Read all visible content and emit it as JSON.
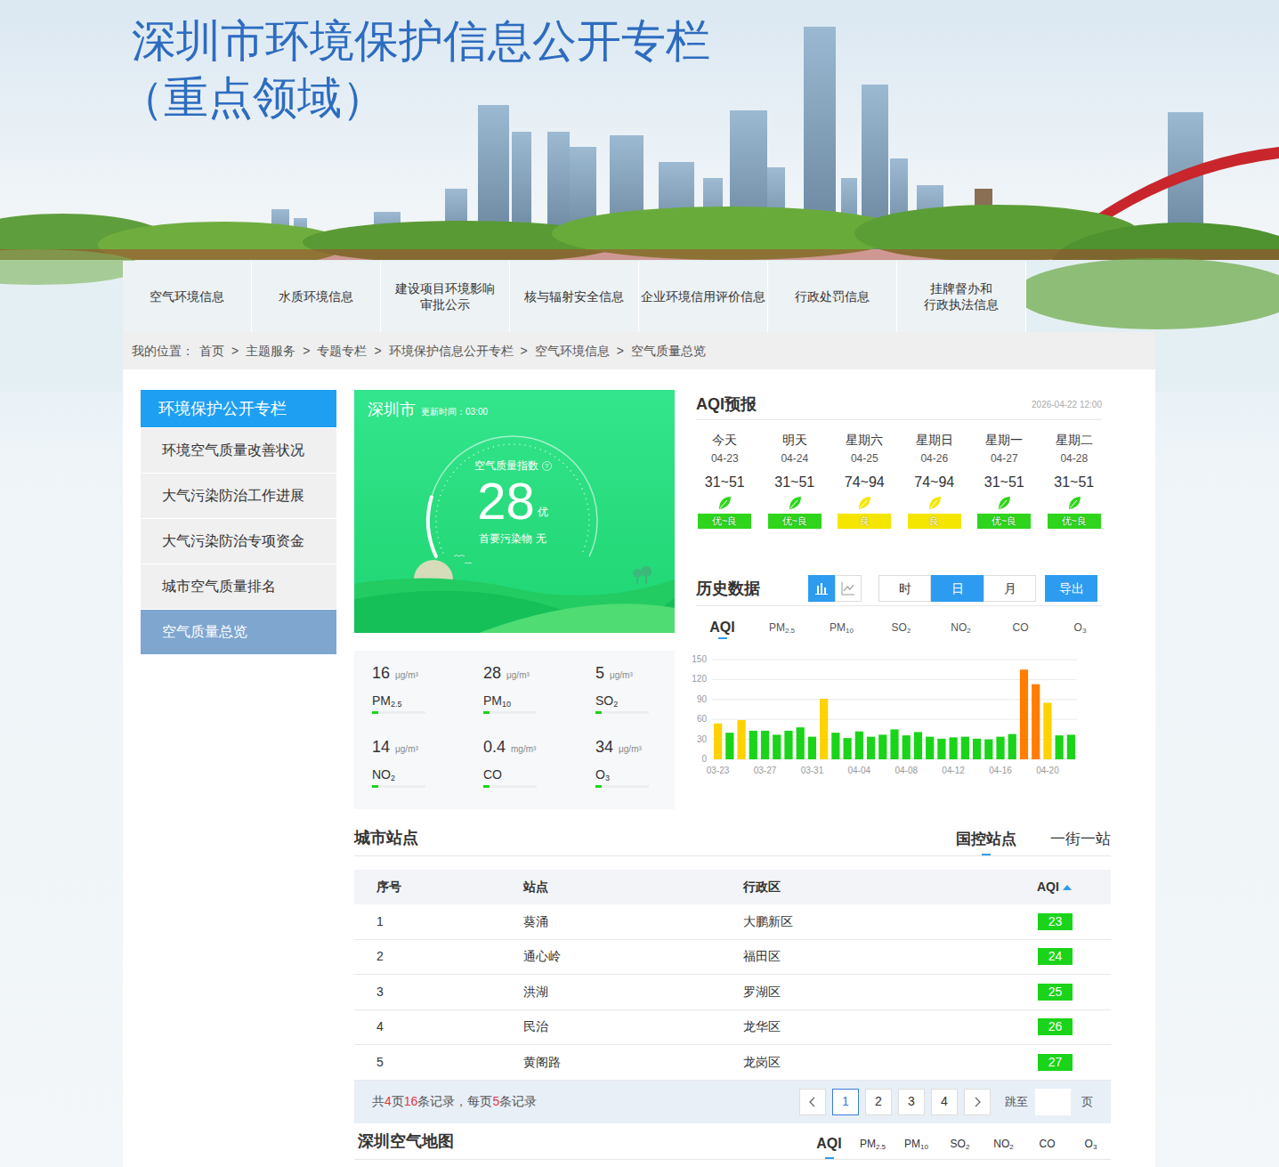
{
  "header": {
    "title": "深圳市环境保护信息公开专栏",
    "subtitle": "（重点领域）"
  },
  "nav": [
    {
      "lines": [
        "空气环境信息"
      ]
    },
    {
      "lines": [
        "水质环境信息"
      ]
    },
    {
      "lines": [
        "建设项目环境影响",
        "审批公示"
      ]
    },
    {
      "lines": [
        "核与辐射安全信息"
      ]
    },
    {
      "lines": [
        "企业环境信用评价信息"
      ]
    },
    {
      "lines": [
        "行政处罚信息"
      ]
    },
    {
      "lines": [
        "挂牌督办和",
        "行政执法信息"
      ]
    }
  ],
  "breadcrumb": {
    "label": "我的位置：",
    "separator": ">",
    "items": [
      "首页",
      "主题服务",
      "专题专栏",
      "环境保护信息公开专栏",
      "空气环境信息",
      "空气质量总览"
    ]
  },
  "sidebar": {
    "title": "环境保护公开专栏",
    "items": [
      {
        "label": "环境空气质量改善状况",
        "selected": false
      },
      {
        "label": "大气污染防治工作进展",
        "selected": false
      },
      {
        "label": "大气污染防治专项资金",
        "selected": false
      },
      {
        "label": "城市空气质量排名",
        "selected": false
      },
      {
        "label": "空气质量总览",
        "selected": true
      }
    ]
  },
  "current": {
    "city": "深圳市",
    "update_label": "更新时间：",
    "update_time": "03:00",
    "index_label": "空气质量指数",
    "help": "?",
    "aqi": "28",
    "grade": "优",
    "gauge": 0.18,
    "primary_label": "首要污染物",
    "primary": "无"
  },
  "pollutants": [
    {
      "value": "16",
      "unit": "μg/m³",
      "name": {
        "base": "PM",
        "sub": "2.5"
      },
      "level": 0.12,
      "color": "#1ad41a"
    },
    {
      "value": "28",
      "unit": "μg/m³",
      "name": {
        "base": "PM",
        "sub": "10"
      },
      "level": 0.12,
      "color": "#1ad41a"
    },
    {
      "value": "5",
      "unit": "μg/m³",
      "name": {
        "base": "SO",
        "sub": "2"
      },
      "level": 0.12,
      "color": "#1ad41a"
    },
    {
      "value": "14",
      "unit": "μg/m³",
      "name": {
        "base": "NO",
        "sub": "2"
      },
      "level": 0.12,
      "color": "#1ad41a"
    },
    {
      "value": "0.4",
      "unit": "mg/m³",
      "name": {
        "base": "CO",
        "sub": ""
      },
      "level": 0.12,
      "color": "#1ad41a"
    },
    {
      "value": "34",
      "unit": "μg/m³",
      "name": {
        "base": "O",
        "sub": "3"
      },
      "level": 0.12,
      "color": "#1ad41a"
    }
  ],
  "forecast": {
    "title": "AQI预报",
    "issued": "2026-04-22 12:00",
    "days": [
      {
        "day": "今天",
        "date": "04-23",
        "range": "31~51",
        "grade": "优~良",
        "color": "#2fd51c"
      },
      {
        "day": "明天",
        "date": "04-24",
        "range": "31~51",
        "grade": "优~良",
        "color": "#2fd51c"
      },
      {
        "day": "星期六",
        "date": "04-25",
        "range": "74~94",
        "grade": "良",
        "color": "#f5e600"
      },
      {
        "day": "星期日",
        "date": "04-26",
        "range": "74~94",
        "grade": "良",
        "color": "#f5e600"
      },
      {
        "day": "星期一",
        "date": "04-27",
        "range": "31~51",
        "grade": "优~良",
        "color": "#2fd51c"
      },
      {
        "day": "星期二",
        "date": "04-28",
        "range": "31~51",
        "grade": "优~良",
        "color": "#2fd51c"
      }
    ]
  },
  "history": {
    "title": "历史数据",
    "chart_types": [
      {
        "kind": "bar",
        "selected": true
      },
      {
        "kind": "line",
        "selected": false
      }
    ],
    "periods": [
      {
        "label": "时",
        "selected": false
      },
      {
        "label": "日",
        "selected": true
      },
      {
        "label": "月",
        "selected": false
      }
    ],
    "export": "导出",
    "tabs": [
      {
        "label": {
          "base": "AQI",
          "sub": ""
        },
        "selected": true
      },
      {
        "label": {
          "base": "PM",
          "sub": "2.5"
        },
        "selected": false
      },
      {
        "label": {
          "base": "PM",
          "sub": "10"
        },
        "selected": false
      },
      {
        "label": {
          "base": "SO",
          "sub": "2"
        },
        "selected": false
      },
      {
        "label": {
          "base": "NO",
          "sub": "2"
        },
        "selected": false
      },
      {
        "label": {
          "base": "CO",
          "sub": ""
        },
        "selected": false
      },
      {
        "label": {
          "base": "O",
          "sub": "3"
        },
        "selected": false
      }
    ],
    "y_ticks": [
      "150",
      "120",
      "90",
      "60",
      "30",
      "0"
    ],
    "x_ticks": [
      {
        "label": "03-23",
        "index": 0
      },
      {
        "label": "03-27",
        "index": 4
      },
      {
        "label": "03-31",
        "index": 8
      },
      {
        "label": "04-04",
        "index": 12
      },
      {
        "label": "04-08",
        "index": 16
      },
      {
        "label": "04-12",
        "index": 20
      },
      {
        "label": "04-16",
        "index": 24
      },
      {
        "label": "04-20",
        "index": 28
      }
    ],
    "values": [
      54,
      40,
      59,
      43,
      43,
      37,
      43,
      48,
      34,
      91,
      40,
      32,
      42,
      34,
      37,
      45,
      36,
      41,
      34,
      31,
      33,
      34,
      31,
      30,
      34,
      38,
      135,
      113,
      85,
      36,
      37
    ],
    "colors": [
      "#ffd200",
      "#1ad41a",
      "#ffd200",
      "#1ad41a",
      "#1ad41a",
      "#1ad41a",
      "#1ad41a",
      "#1ad41a",
      "#1ad41a",
      "#ffd200",
      "#1ad41a",
      "#1ad41a",
      "#1ad41a",
      "#1ad41a",
      "#1ad41a",
      "#1ad41a",
      "#1ad41a",
      "#1ad41a",
      "#1ad41a",
      "#1ad41a",
      "#1ad41a",
      "#1ad41a",
      "#1ad41a",
      "#1ad41a",
      "#1ad41a",
      "#1ad41a",
      "#ff7e00",
      "#ff7e00",
      "#ffd200",
      "#1ad41a",
      "#1ad41a"
    ]
  },
  "stations": {
    "title": "城市站点",
    "tabs": [
      {
        "label": "国控站点",
        "selected": true
      },
      {
        "label": "一街一站",
        "selected": false
      }
    ],
    "columns": [
      "序号",
      "站点",
      "行政区",
      "AQI"
    ],
    "rows": [
      {
        "no": "1",
        "station": "葵涌",
        "district": "大鹏新区",
        "aqi": "23",
        "color": "#1ad41a"
      },
      {
        "no": "2",
        "station": "通心岭",
        "district": "福田区",
        "aqi": "24",
        "color": "#1ad41a"
      },
      {
        "no": "3",
        "station": "洪湖",
        "district": "罗湖区",
        "aqi": "25",
        "color": "#1ad41a"
      },
      {
        "no": "4",
        "station": "民治",
        "district": "龙华区",
        "aqi": "26",
        "color": "#1ad41a"
      },
      {
        "no": "5",
        "station": "黄阁路",
        "district": "龙岗区",
        "aqi": "27",
        "color": "#1ad41a"
      }
    ],
    "pagination": {
      "summary": [
        {
          "text": "共",
          "highlight": false
        },
        {
          "text": "4",
          "highlight": true
        },
        {
          "text": "页",
          "highlight": false
        },
        {
          "text": "16",
          "highlight": true
        },
        {
          "text": "条记录，每页",
          "highlight": false
        },
        {
          "text": "5",
          "highlight": true
        },
        {
          "text": "条记录",
          "highlight": false
        }
      ],
      "pages": [
        {
          "label": "1",
          "selected": true
        },
        {
          "label": "2",
          "selected": false
        },
        {
          "label": "3",
          "selected": false
        },
        {
          "label": "4",
          "selected": false
        }
      ],
      "jump_label": "跳至",
      "jump_value": "",
      "page_unit": "页"
    }
  },
  "map": {
    "title": "深圳空气地图",
    "tabs": [
      {
        "label": {
          "base": "AQI",
          "sub": ""
        },
        "selected": true
      },
      {
        "label": {
          "base": "PM",
          "sub": "2.5"
        },
        "selected": false
      },
      {
        "label": {
          "base": "PM",
          "sub": "10"
        },
        "selected": false
      },
      {
        "label": {
          "base": "SO",
          "sub": "2"
        },
        "selected": false
      },
      {
        "label": {
          "base": "NO",
          "sub": "2"
        },
        "selected": false
      },
      {
        "label": {
          "base": "CO",
          "sub": ""
        },
        "selected": false
      },
      {
        "label": {
          "base": "O",
          "sub": "3"
        },
        "selected": false
      }
    ]
  }
}
